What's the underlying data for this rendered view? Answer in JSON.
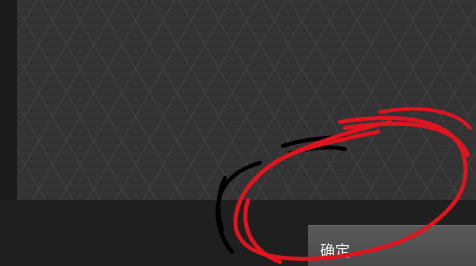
{
  "dialog": {
    "confirm_label": "确定"
  },
  "annotation": {
    "red_stroke_color": "#e0141e",
    "black_stroke_color": "#000000"
  },
  "theme": {
    "panel_color": "#343434",
    "footer_color": "#1f1f1f",
    "button_color": "#555555"
  }
}
